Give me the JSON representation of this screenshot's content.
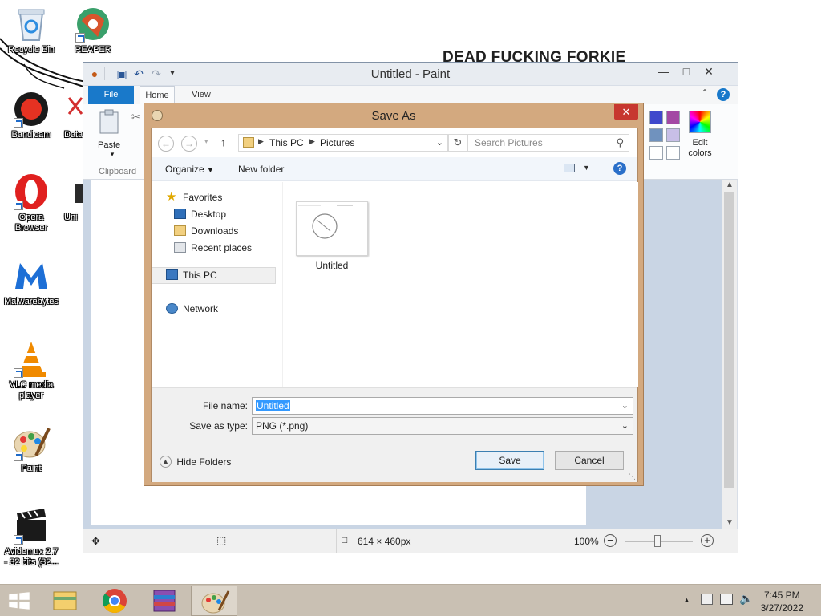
{
  "desktop": {
    "background_text": "DEAD FUCKING FORKIE",
    "icons": [
      {
        "label": "Recycle Bin",
        "icon": "recycle-bin-icon"
      },
      {
        "label": "REAPER",
        "icon": "reaper-icon"
      },
      {
        "label": "Bandicam",
        "icon": "bandicam-icon"
      },
      {
        "label": "Data",
        "icon": "data-icon"
      },
      {
        "label": "Opera\nBrowser",
        "icon": "opera-icon"
      },
      {
        "label": "Uni",
        "icon": "uni-icon"
      },
      {
        "label": "Malwarebytes",
        "icon": "malwarebytes-icon"
      },
      {
        "label": "VLC media\nplayer",
        "icon": "vlc-icon"
      },
      {
        "label": "Paint",
        "icon": "paint-icon"
      },
      {
        "label": "Avidemux 2.7\n- 32 bits (32...",
        "icon": "avidemux-icon"
      }
    ]
  },
  "paint": {
    "title": "Untitled - Paint",
    "tabs": {
      "file": "File",
      "home": "Home",
      "view": "View"
    },
    "ribbon": {
      "paste": "Paste",
      "clipboard": "Clipboard",
      "edit_colors": "Edit\ncolors"
    },
    "status": {
      "dimensions": "614 × 460px",
      "zoom": "100%"
    },
    "palette": [
      "#3f48cc",
      "#a349a4",
      "#7092be",
      "#c8bfe7",
      "#ffffff",
      "#ffffff"
    ]
  },
  "dialog": {
    "title": "Save As",
    "breadcrumb": [
      "This PC",
      "Pictures"
    ],
    "search_placeholder": "Search Pictures",
    "toolbar": {
      "organize": "Organize",
      "new_folder": "New folder"
    },
    "nav": {
      "favorites": "Favorites",
      "desktop": "Desktop",
      "downloads": "Downloads",
      "recent": "Recent places",
      "this_pc": "This PC",
      "network": "Network"
    },
    "files": [
      {
        "name": "Untitled"
      }
    ],
    "file_name_label": "File name:",
    "file_name_value": "Untitled",
    "save_type_label": "Save as type:",
    "save_type_value": "PNG (*.png)",
    "hide_folders": "Hide Folders",
    "save": "Save",
    "cancel": "Cancel"
  },
  "taskbar": {
    "clock_time": "7:45 PM",
    "clock_date": "3/27/2022"
  }
}
